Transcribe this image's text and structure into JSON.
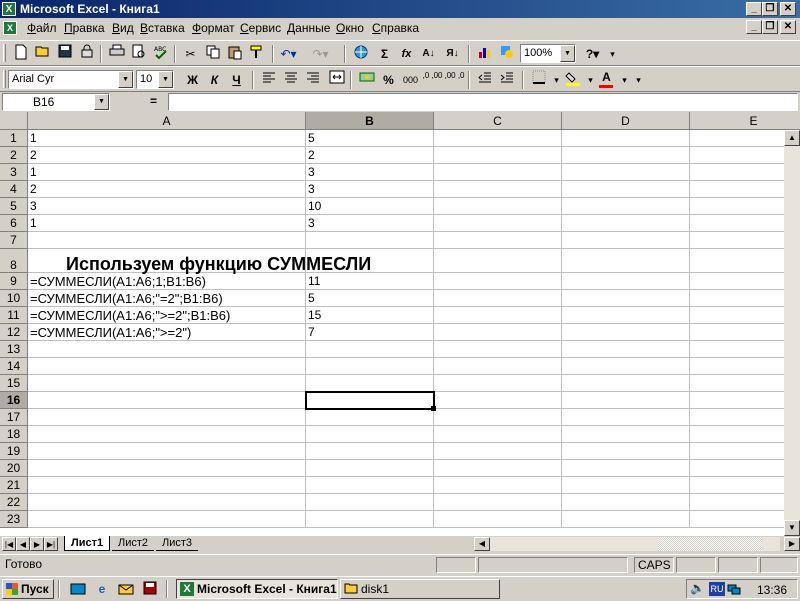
{
  "window": {
    "title": "Microsoft Excel - Книга1",
    "app_icon": "X",
    "controls": [
      "_",
      "❐",
      "✕"
    ]
  },
  "menu": {
    "items": [
      "Файл",
      "Правка",
      "Вид",
      "Вставка",
      "Формат",
      "Сервис",
      "Данные",
      "Окно",
      "Справка"
    ],
    "doc_controls": [
      "_",
      "❐",
      "✕"
    ]
  },
  "toolbar_standard": {
    "zoom": "100%",
    "icons": [
      "new-icon",
      "open-icon",
      "save-icon",
      "permission-icon",
      "print-icon",
      "print-preview-icon",
      "spelling-icon",
      "cut-icon",
      "copy-icon",
      "paste-icon",
      "format-painter-icon",
      "undo-icon",
      "redo-icon",
      "hyperlink-icon",
      "autosum-icon",
      "function-icon",
      "sort-asc-icon",
      "sort-desc-icon",
      "chart-wizard-icon",
      "drawing-icon",
      "help-icon"
    ],
    "glyphs": {
      "autosum": "Σ",
      "function": "fx",
      "sort_asc": "А↓",
      "sort_desc": "Я↓",
      "help": "?"
    }
  },
  "toolbar_format": {
    "font_name": "Arial Cyr",
    "font_size": "10",
    "bold": "Ж",
    "italic": "К",
    "underline": "Ч",
    "percent": "%",
    "thousands": "000",
    "inc_decimal": ",0 ,00",
    "dec_decimal": ",00 ,0",
    "fill_color": "#ffff00",
    "font_color": "#ff0000",
    "font_color_glyph": "A"
  },
  "formula_bar": {
    "name_box": "B16",
    "equals": "=",
    "value": ""
  },
  "grid": {
    "columns": [
      "A",
      "B",
      "C",
      "D",
      "E"
    ],
    "active_column": "B",
    "rows": [
      "1",
      "2",
      "3",
      "4",
      "5",
      "6",
      "7",
      "8",
      "9",
      "10",
      "11",
      "12",
      "13",
      "14",
      "15",
      "16",
      "17",
      "18",
      "19",
      "20",
      "21",
      "22",
      "23"
    ],
    "active_row": "16",
    "cells": {
      "A1": "1",
      "B1": "5",
      "A2": "2",
      "B2": "2",
      "A3": "1",
      "B3": "3",
      "A4": "2",
      "B4": "3",
      "A5": "3",
      "B5": "10",
      "A6": "1",
      "B6": "3",
      "A8": "Используем функцию СУММЕСЛИ",
      "A9": "=СУММЕСЛИ(A1:A6;1;B1:B6)",
      "B9": "11",
      "A10": "=СУММЕСЛИ(A1:A6;\"=2\";B1:B6)",
      "B10": "5",
      "A11": "=СУММЕСЛИ(A1:A6;\">=2\";B1:B6)",
      "B11": "15",
      "A12": "=СУММЕСЛИ(A1:A6;\">=2\")",
      "B12": "7"
    }
  },
  "sheets": {
    "tabs": [
      "Лист1",
      "Лист2",
      "Лист3"
    ],
    "active": "Лист1"
  },
  "status": {
    "ready": "Готово",
    "caps": "CAPS"
  },
  "taskbar": {
    "start": "Пуск",
    "tasks": [
      {
        "label": "Microsoft Excel - Книга1",
        "active": true,
        "icon": "excel-icon"
      },
      {
        "label": "disk1",
        "active": false,
        "icon": "folder-icon"
      }
    ],
    "lang": "RU",
    "clock": "13:36"
  }
}
